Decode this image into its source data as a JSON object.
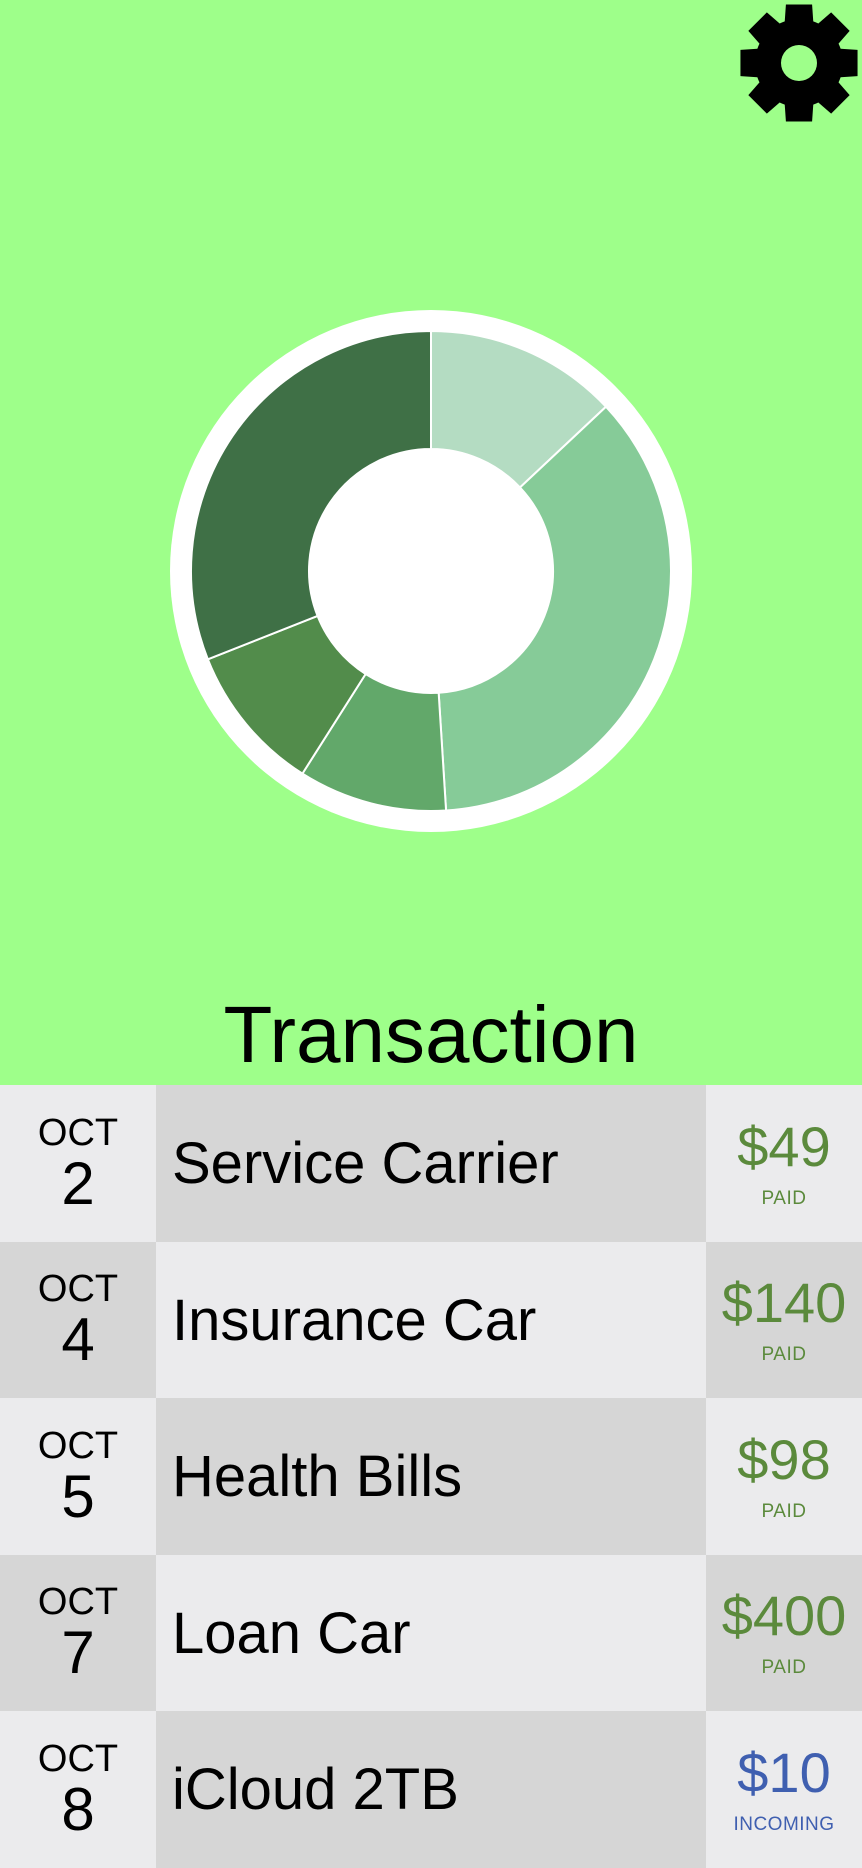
{
  "header": {
    "settings_icon": "gear-icon",
    "title": "Transaction"
  },
  "colors": {
    "background": "#9eff8a",
    "paid": "#5b8a3c",
    "incoming": "#3f5fb0",
    "row_light": "#ebebed",
    "row_dark": "#d6d6d6"
  },
  "chart_data": {
    "type": "pie",
    "variant": "donut",
    "slices": [
      {
        "value": 13,
        "color": "#b4dcc2"
      },
      {
        "value": 36,
        "color": "#86cb98"
      },
      {
        "value": 10,
        "color": "#62a86a"
      },
      {
        "value": 10,
        "color": "#528c4b"
      },
      {
        "value": 31,
        "color": "#3f7046"
      }
    ]
  },
  "transactions": [
    {
      "month": "OCT",
      "day": "2",
      "name": "Service Carrier",
      "amount": "$49",
      "status": "PAID",
      "status_type": "paid"
    },
    {
      "month": "OCT",
      "day": "4",
      "name": "Insurance Car",
      "amount": "$140",
      "status": "PAID",
      "status_type": "paid"
    },
    {
      "month": "OCT",
      "day": "5",
      "name": "Health Bills",
      "amount": "$98",
      "status": "PAID",
      "status_type": "paid"
    },
    {
      "month": "OCT",
      "day": "7",
      "name": "Loan Car",
      "amount": "$400",
      "status": "PAID",
      "status_type": "paid"
    },
    {
      "month": "OCT",
      "day": "8",
      "name": "iCloud 2TB",
      "amount": "$10",
      "status": "INCOMING",
      "status_type": "incoming"
    }
  ]
}
